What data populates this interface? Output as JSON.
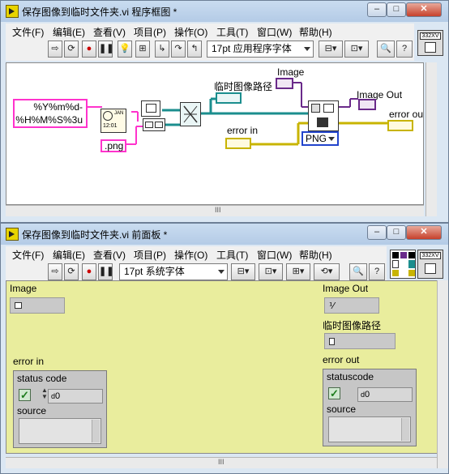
{
  "diagram_window": {
    "title": "保存图像到临时文件夹.vi 程序框图 *",
    "menus": [
      "文件(F)",
      "编辑(E)",
      "查看(V)",
      "项目(P)",
      "操作(O)",
      "工具(T)",
      "窗口(W)",
      "帮助(H)"
    ],
    "font_selector": "17pt 应用程序字体",
    "diagram": {
      "format_string": "%Y%m%d-\n%H%M%S%3u",
      "extension": ".png",
      "temp_path_label": "临时图像路径",
      "image_label": "Image",
      "image_out_label": "Image Out",
      "error_in_label": "error in",
      "error_out_label": "error out",
      "format_enum": "PNG"
    },
    "scrollbar_mark": "III"
  },
  "panel_window": {
    "title": "保存图像到临时文件夹.vi 前面板 *",
    "menus": [
      "文件(F)",
      "编辑(E)",
      "查看(V)",
      "项目(P)",
      "操作(O)",
      "工具(T)",
      "窗口(W)",
      "帮助(H)"
    ],
    "font_selector": "17pt 系统字体",
    "controls": {
      "image_label": "Image",
      "image_out_label": "Image Out",
      "temp_path_label": "临时图像路径",
      "error_in_label": "error in",
      "error_out_label": "error out",
      "status_code_left": "status code",
      "status_code_right": "statuscode",
      "code_value_left": "0",
      "code_value_right": "0",
      "source_label": "source",
      "code_prefix": "d"
    },
    "scrollbar_mark": "III"
  },
  "icon_names": [
    "run-arrow-icon",
    "run-continuous-icon",
    "abort-icon",
    "pause-icon",
    "highlight-execution-icon",
    "retain-wire-values-icon",
    "step-into-icon",
    "step-over-icon",
    "step-out-icon",
    "align-icon",
    "distribute-icon",
    "reorder-icon",
    "search-icon",
    "help-icon",
    "vi-icon",
    "connector-pane-icon"
  ]
}
